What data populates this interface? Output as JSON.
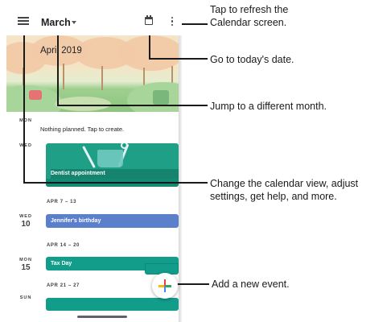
{
  "app_bar": {
    "month": "March",
    "menu_icon": "hamburger-menu-icon",
    "today_icon": "calendar-today-icon",
    "overflow_icon": "more-vert-icon"
  },
  "banner": {
    "month_label": "April 2019"
  },
  "agenda": {
    "days": [
      {
        "abbr": "MON",
        "num": ""
      },
      {
        "abbr": "WED",
        "num": ""
      },
      {
        "abbr": "WED",
        "num": "10"
      },
      {
        "abbr": "MON",
        "num": "15"
      },
      {
        "abbr": "SUN",
        "num": ""
      }
    ],
    "empty_message": "Nothing planned. Tap to create.",
    "ranges": [
      "APR 7 – 13",
      "APR 14 – 20",
      "APR 21 – 27"
    ],
    "events": [
      {
        "title": "Dentist appointment",
        "color": "#1f9f86"
      },
      {
        "title": "Jennifer's birthday",
        "color": "#5b80cb"
      },
      {
        "title": "Tax Day",
        "color": "#129d8a"
      }
    ]
  },
  "fab": {
    "icon": "add-plus-icon"
  },
  "callouts": [
    {
      "text_line1": "Tap to refresh the",
      "text_line2": "Calendar screen."
    },
    {
      "text_line1": "Go to today's date."
    },
    {
      "text_line1": "Jump to a different month."
    },
    {
      "text_line1": "Change the calendar view, adjust",
      "text_line2": "settings, get help, and more."
    },
    {
      "text_line1": "Add a new event."
    }
  ]
}
